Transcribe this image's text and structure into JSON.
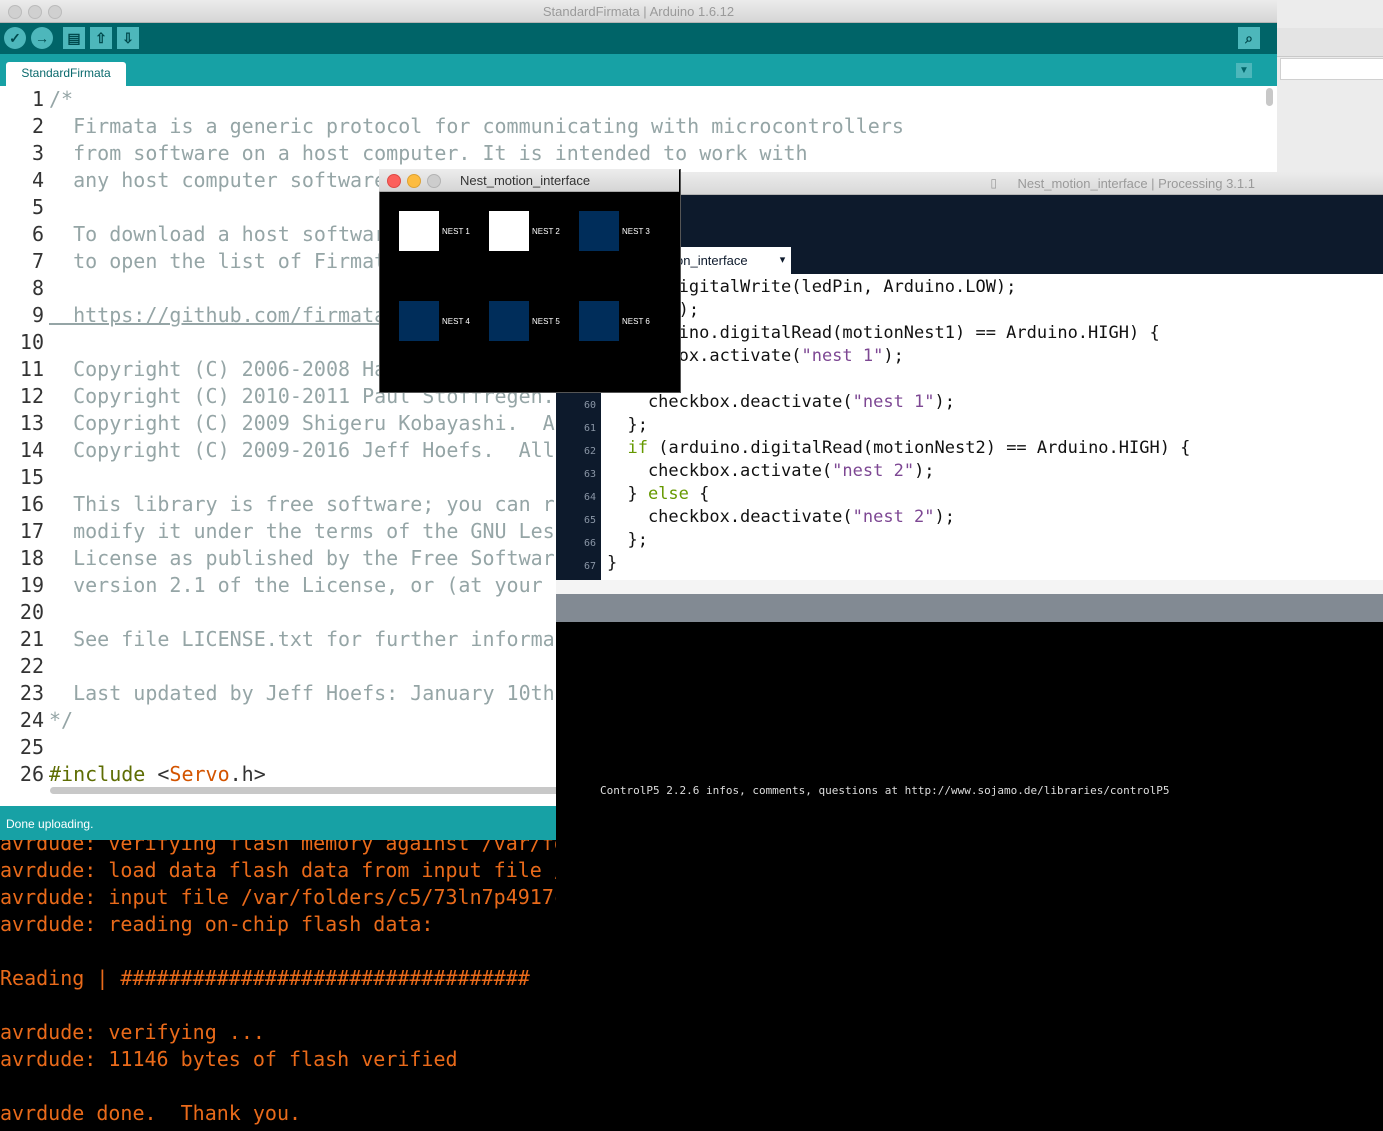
{
  "arduino": {
    "window_title": "StandardFirmata | Arduino 1.6.12",
    "tab_label": "StandardFirmata",
    "tab_menu_icon": "▼",
    "toolbar": {
      "verify_icon": "✓",
      "upload_icon": "→",
      "new_icon": "▤",
      "open_icon": "⇧",
      "save_icon": "⇩",
      "serial_monitor_icon": "⌕"
    },
    "line_numbers": [
      "1",
      "2",
      "3",
      "4",
      "5",
      "6",
      "7",
      "8",
      "9",
      "10",
      "11",
      "12",
      "13",
      "14",
      "15",
      "16",
      "17",
      "18",
      "19",
      "20",
      "21",
      "22",
      "23",
      "24",
      "25",
      "26"
    ],
    "code_lines": [
      "/*",
      "  Firmata is a generic protocol for communicating with microcontrollers",
      "  from software on a host computer. It is intended to work with",
      "  any host computer software",
      "",
      "  To download a host softwar",
      "  to open the list of Firmat",
      "",
      "  https://github.com/firmata",
      "",
      "  Copyright (C) 2006-2008 Ha",
      "  Copyright (C) 2010-2011 Paul Stoffregen.",
      "  Copyright (C) 2009 Shigeru Kobayashi.  A",
      "  Copyright (C) 2009-2016 Jeff Hoefs.  All",
      "",
      "  This library is free software; you can r",
      "  modify it under the terms of the GNU Les",
      "  License as published by the Free Softwar",
      "  version 2.1 of the License, or (at your ",
      "",
      "  See file LICENSE.txt for further informa",
      "",
      "  Last updated by Jeff Hoefs: January 10th",
      "*/",
      ""
    ],
    "include_line": {
      "directive": "#include",
      "open": " <",
      "lib": "Servo",
      "ext": ".h>"
    },
    "status": "Done uploading.",
    "console_lines": [
      "avrdude: verifying flash memory against /var/fo",
      "avrdude: load data flash data from input file /",
      "avrdude: input file /var/folders/c5/73ln7p4917c",
      "avrdude: reading on-chip flash data:",
      "",
      "Reading | ##################################",
      "",
      "avrdude: verifying ...",
      "avrdude: 11146 bytes of flash verified",
      "",
      "avrdude done.  Thank you."
    ]
  },
  "sketch": {
    "window_title": "Nest_motion_interface",
    "nests": [
      {
        "label": "NEST 1",
        "active": true
      },
      {
        "label": "NEST 2",
        "active": true
      },
      {
        "label": "NEST 3",
        "active": false
      },
      {
        "label": "NEST 4",
        "active": false
      },
      {
        "label": "NEST 5",
        "active": false
      },
      {
        "label": "NEST 6",
        "active": false
      }
    ],
    "colors": {
      "active": "#ffffff",
      "inactive": "#002d5a",
      "background": "#000000"
    }
  },
  "processing": {
    "window_title": "Nest_motion_interface | Processing 3.1.1",
    "tab_label": "on_interface",
    "tab_menu_icon": "▾",
    "line_numbers": [
      "",
      "",
      "",
      "",
      "",
      "60",
      "61",
      "62",
      "63",
      "64",
      "65",
      "66",
      "67"
    ],
    "console_text": "ControlP5 2.2.6 infos, comments, questions at http://www.sojamo.de/libraries/controlP5"
  },
  "colors": {
    "arduino_teal": "#006468",
    "arduino_tab_bar": "#17a1a5",
    "processing_dark": "#0d1a2c",
    "console_orange": "#e96a1a"
  }
}
